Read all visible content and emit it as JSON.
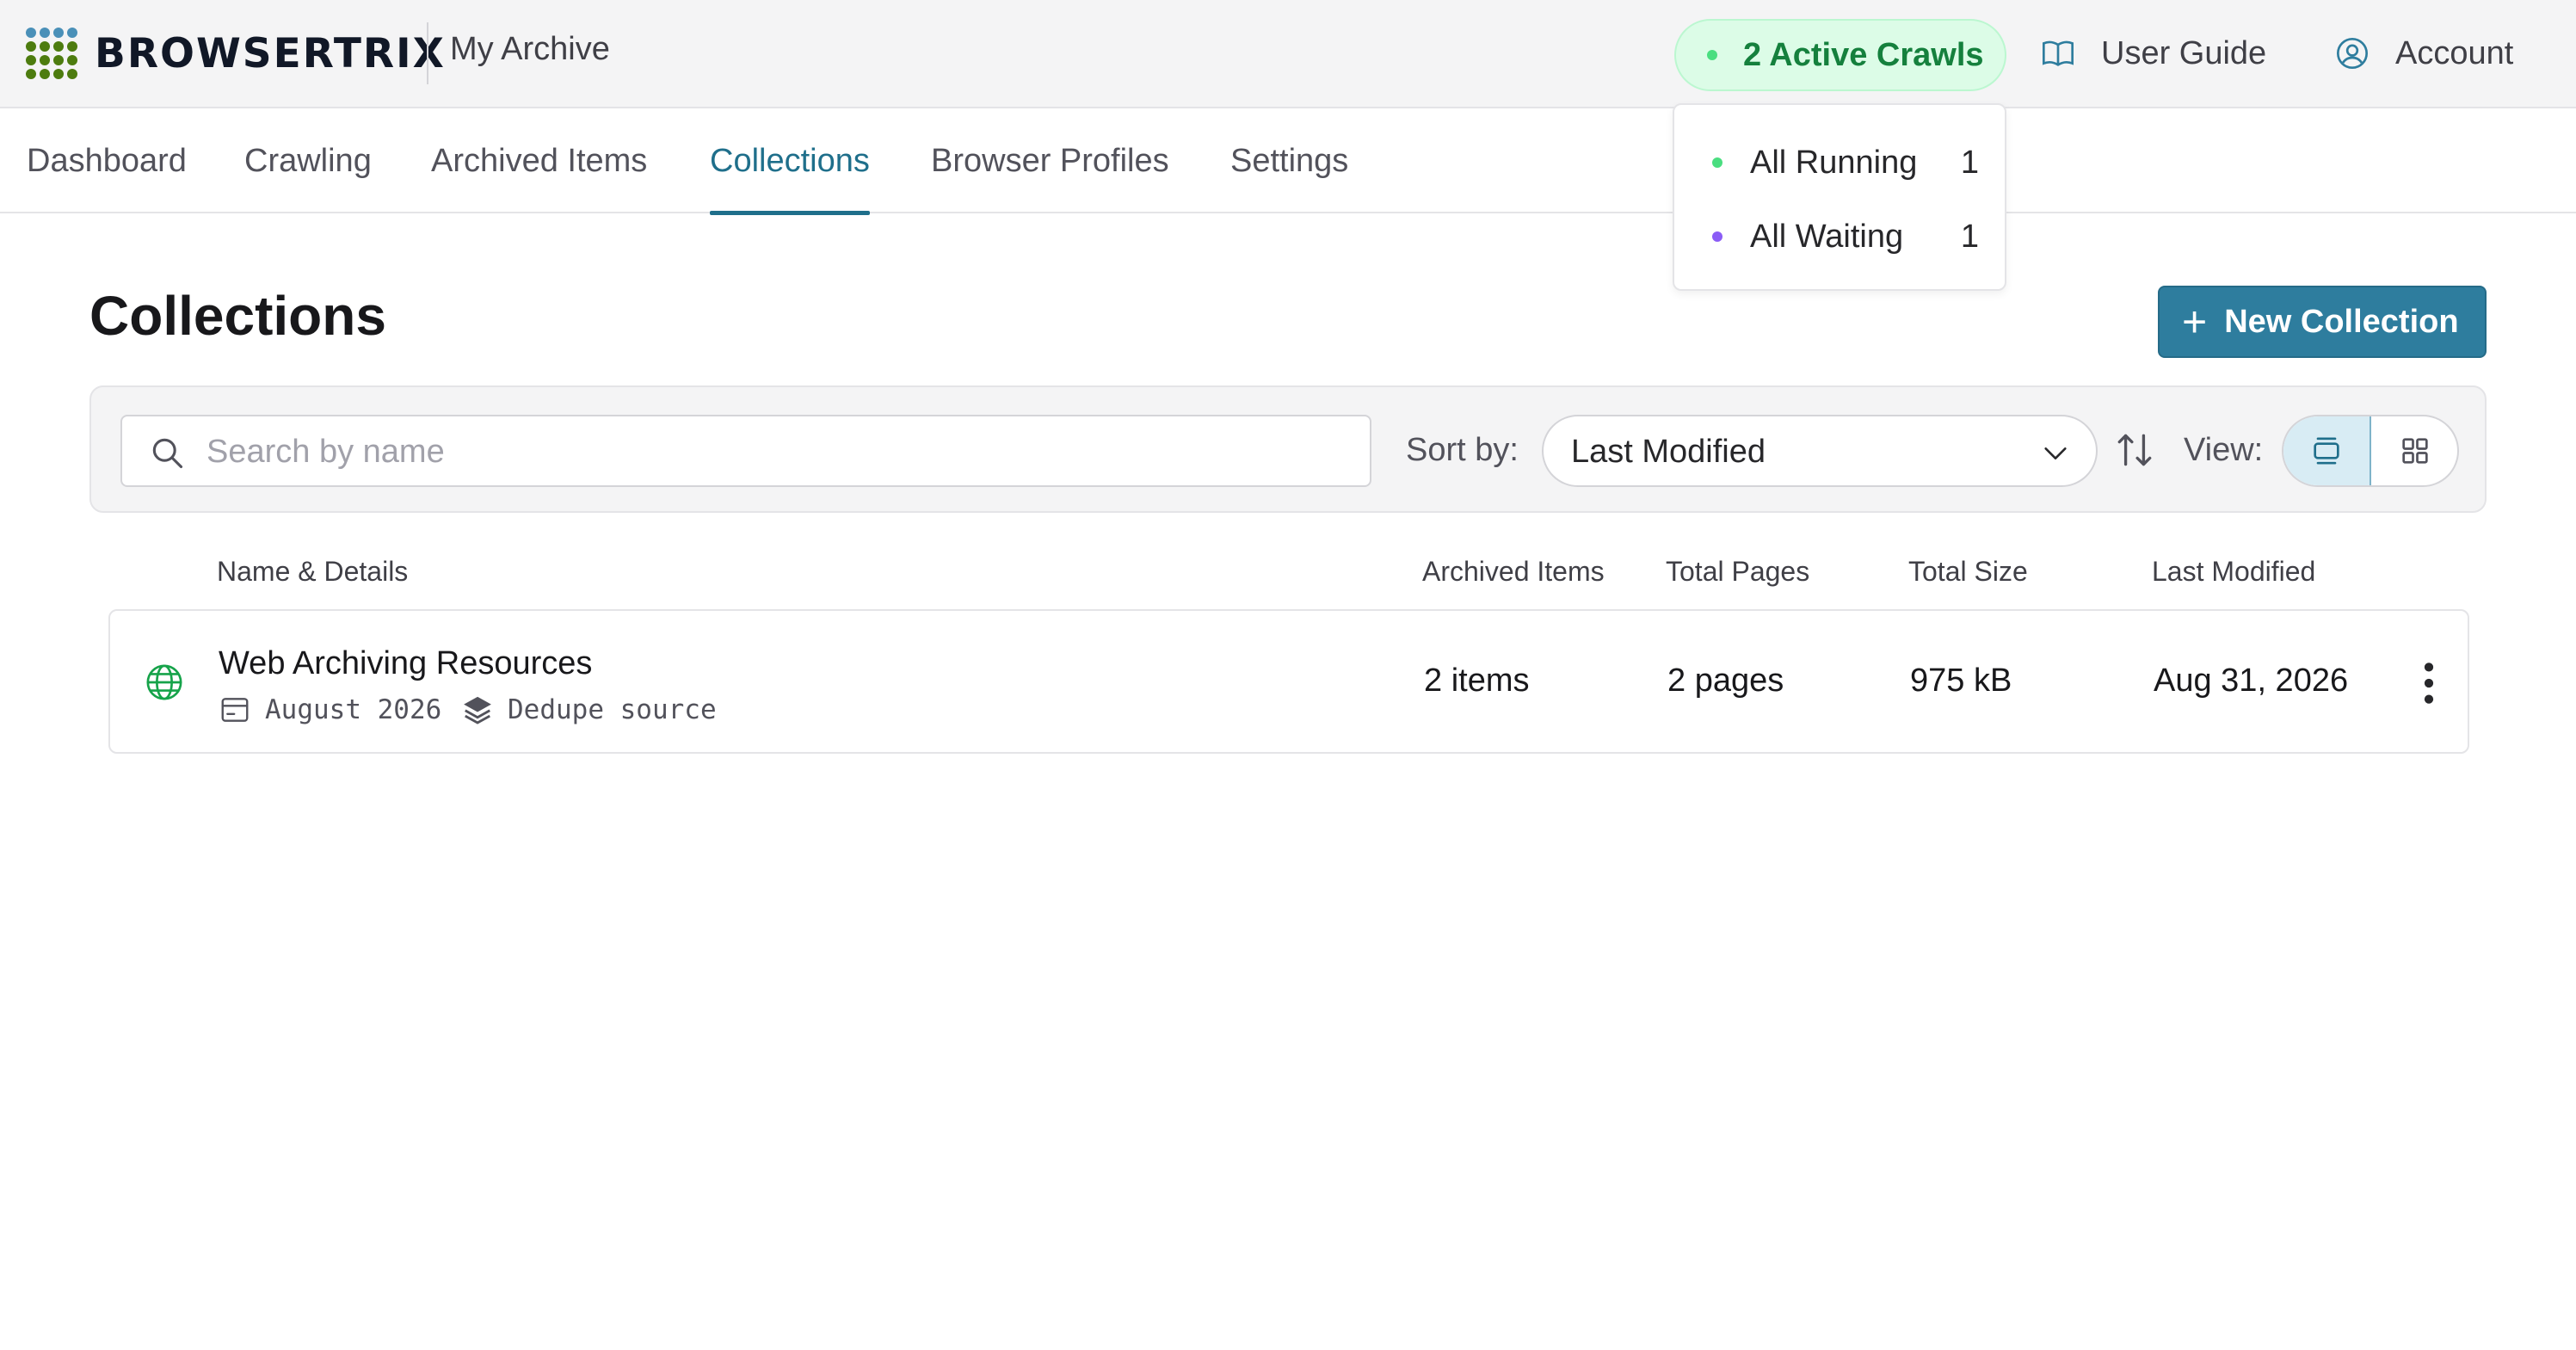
{
  "app": {
    "logo_text": "BROWSERTRIX",
    "org_name": "My Archive"
  },
  "header": {
    "active_crawls_label": "2 Active Crawls",
    "user_guide_label": "User Guide",
    "account_label": "Account"
  },
  "crawl_menu": {
    "items": [
      {
        "label": "All Running",
        "count": "1",
        "color": "#4ade80"
      },
      {
        "label": "All Waiting",
        "count": "1",
        "color": "#8b5cf6"
      }
    ]
  },
  "nav": {
    "tabs": [
      {
        "label": "Dashboard",
        "active": false
      },
      {
        "label": "Crawling",
        "active": false
      },
      {
        "label": "Archived Items",
        "active": false
      },
      {
        "label": "Collections",
        "active": true
      },
      {
        "label": "Browser Profiles",
        "active": false
      },
      {
        "label": "Settings",
        "active": false
      }
    ]
  },
  "page": {
    "title": "Collections",
    "new_button_label": "New Collection",
    "new_button_icon": "plus-icon"
  },
  "filters": {
    "search_placeholder": "Search by name",
    "search_value": "",
    "sort_label": "Sort by:",
    "sort_value": "Last Modified",
    "view_label": "View:",
    "view_selected": "list"
  },
  "table": {
    "headers": {
      "name": "Name & Details",
      "archived_items": "Archived Items",
      "total_pages": "Total Pages",
      "total_size": "Total Size",
      "last_modified": "Last Modified"
    },
    "rows": [
      {
        "name": "Web Archiving Resources",
        "date_range": "August 2026",
        "tag": "Dedupe source",
        "archived_items": "2 items",
        "total_pages": "2 pages",
        "total_size": "975 kB",
        "last_modified": "Aug 31, 2026"
      }
    ]
  },
  "colors": {
    "brand": "#2e7d9e",
    "active_tab": "#1f6f8b",
    "active_pill_bg": "#dcfce7",
    "active_pill_text": "#15803d",
    "globe": "#16a34a"
  }
}
